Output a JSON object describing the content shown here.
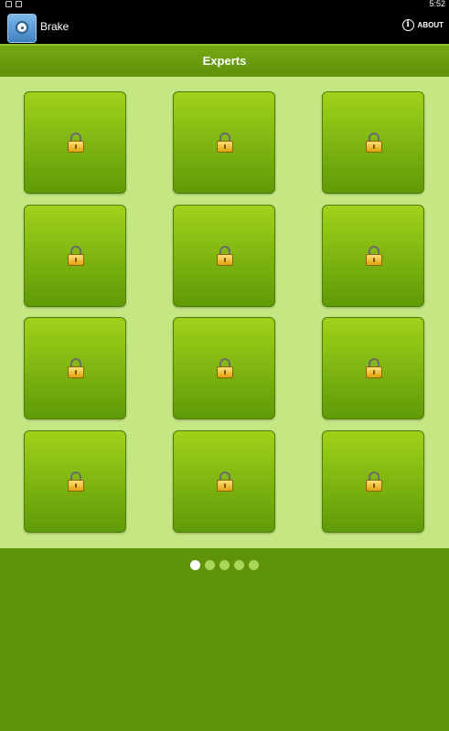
{
  "status_bar": {
    "time": "5:52"
  },
  "action_bar": {
    "app_title": "Brake",
    "about_label": "ABOUT",
    "info_glyph": "i"
  },
  "header": {
    "title": "Experts"
  },
  "levels": [
    {
      "state": "locked",
      "icon": "lock-icon"
    },
    {
      "state": "locked",
      "icon": "lock-icon"
    },
    {
      "state": "locked",
      "icon": "lock-icon"
    },
    {
      "state": "locked",
      "icon": "lock-icon"
    },
    {
      "state": "locked",
      "icon": "lock-icon"
    },
    {
      "state": "locked",
      "icon": "lock-icon"
    },
    {
      "state": "locked",
      "icon": "lock-icon"
    },
    {
      "state": "locked",
      "icon": "lock-icon"
    },
    {
      "state": "locked",
      "icon": "lock-icon"
    },
    {
      "state": "locked",
      "icon": "lock-icon"
    },
    {
      "state": "locked",
      "icon": "lock-icon"
    },
    {
      "state": "locked",
      "icon": "lock-icon"
    }
  ],
  "pager": {
    "page_count": 5,
    "active_page": 1
  },
  "colors": {
    "background": "#5e9208",
    "panel": "#c4e683",
    "tile_top": "#a0d21a",
    "tile_bottom": "#5f9a08",
    "dot_active": "#ffffff",
    "dot_inactive": "#a9d55a"
  }
}
